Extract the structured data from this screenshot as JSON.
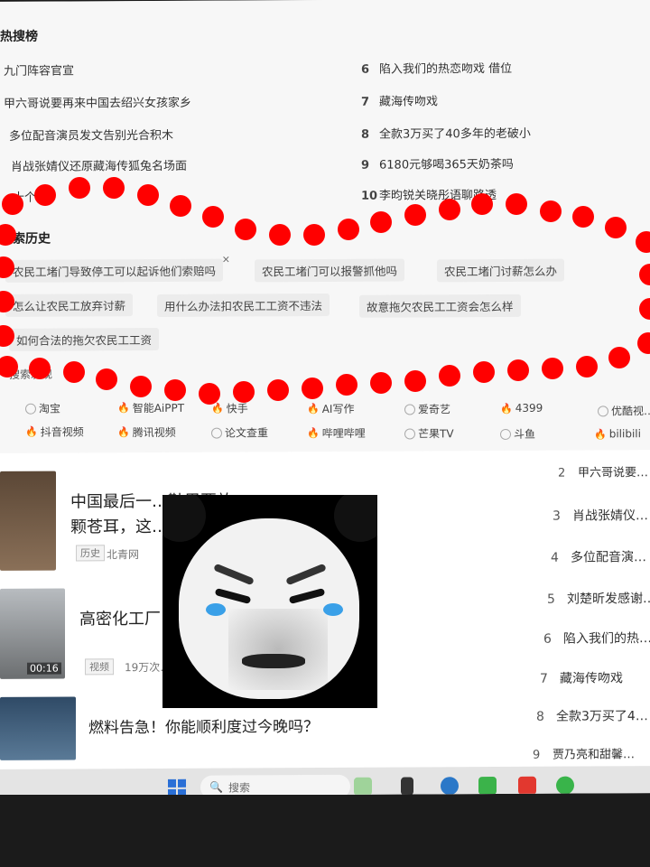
{
  "hot_search": {
    "title": "热搜榜",
    "left": [
      {
        "num": "",
        "text": "九门阵容官宣"
      },
      {
        "num": "",
        "text": "甲六哥说要再来中国去绍兴女孩家乡"
      },
      {
        "num": "",
        "text": "多位配音演员发文告别光合积木"
      },
      {
        "num": "",
        "text": "肖战张婧仪还原藏海传狐兔名场面"
      },
      {
        "num": "",
        "text": "十个…"
      }
    ],
    "right": [
      {
        "num": "6",
        "text": "陷入我们的热恋吻戏 借位"
      },
      {
        "num": "7",
        "text": "藏海传吻戏"
      },
      {
        "num": "8",
        "text": "全款3万买了40多年的老破小"
      },
      {
        "num": "9",
        "text": "6180元够喝365天奶茶吗"
      },
      {
        "num": "10",
        "text": "李昀锐关晓彤语聊路透"
      }
    ]
  },
  "search_history": {
    "title": "搜索历史",
    "items": [
      "农民工堵门导致停工可以起诉他们索赔吗",
      "农民工堵门可以报警抓他吗",
      "农民工堵门讨薪怎么办",
      "怎么让农民工放弃讨薪",
      "用什么办法扣农民工工资不违法",
      "故意拖欠农民工工资会怎么样",
      "如何合法的拖欠农民工工资"
    ],
    "close_glyph": "×"
  },
  "recommended": {
    "title": "搜索发现",
    "row1": [
      {
        "label": "淘宝",
        "icon": "globe"
      },
      {
        "label": "智能AiPPT",
        "icon": "fire"
      },
      {
        "label": "快手",
        "icon": "fire"
      },
      {
        "label": "AI写作",
        "icon": "fire"
      },
      {
        "label": "爱奇艺",
        "icon": "globe"
      },
      {
        "label": "4399",
        "icon": "fire"
      },
      {
        "label": "优酷视…",
        "icon": "globe"
      }
    ],
    "row2": [
      {
        "label": "抖音视频",
        "icon": "fire"
      },
      {
        "label": "腾讯视频",
        "icon": "fire"
      },
      {
        "label": "论文查重",
        "icon": "globe"
      },
      {
        "label": "哔哩哔哩",
        "icon": "fire"
      },
      {
        "label": "芒果TV",
        "icon": "globe"
      },
      {
        "label": "斗鱼",
        "icon": "globe"
      },
      {
        "label": "bilibili",
        "icon": "fire"
      }
    ]
  },
  "feed": {
    "items": [
      {
        "title_line1": "中国最后一…鞋里要放一",
        "title_line2": "颗苍耳，这…",
        "tag": "历史",
        "source": "北青网"
      },
      {
        "title_line1": "高密化工厂…",
        "tag": "视频",
        "meta": "19万次…",
        "duration": "00:16"
      },
      {
        "title_line1": "燃料告急！你能顺利度过今晚吗？"
      }
    ]
  },
  "ranking": {
    "items": [
      {
        "num": "2",
        "text": "甲六哥说要…"
      },
      {
        "num": "3",
        "text": "肖战张婧仪…"
      },
      {
        "num": "4",
        "text": "多位配音演…"
      },
      {
        "num": "5",
        "text": "刘楚昕发感谢…"
      },
      {
        "num": "6",
        "text": "陷入我们的热…"
      },
      {
        "num": "7",
        "text": "藏海传吻戏"
      },
      {
        "num": "8",
        "text": "全款3万买了4…"
      },
      {
        "num": "9",
        "text": "贾乃亮和甜馨…"
      }
    ]
  },
  "taskbar": {
    "search_placeholder": "搜索"
  },
  "colors": {
    "dot_red": "#ff0000",
    "fire_red": "#e0442d",
    "win_blue": "#2a6fd6"
  }
}
